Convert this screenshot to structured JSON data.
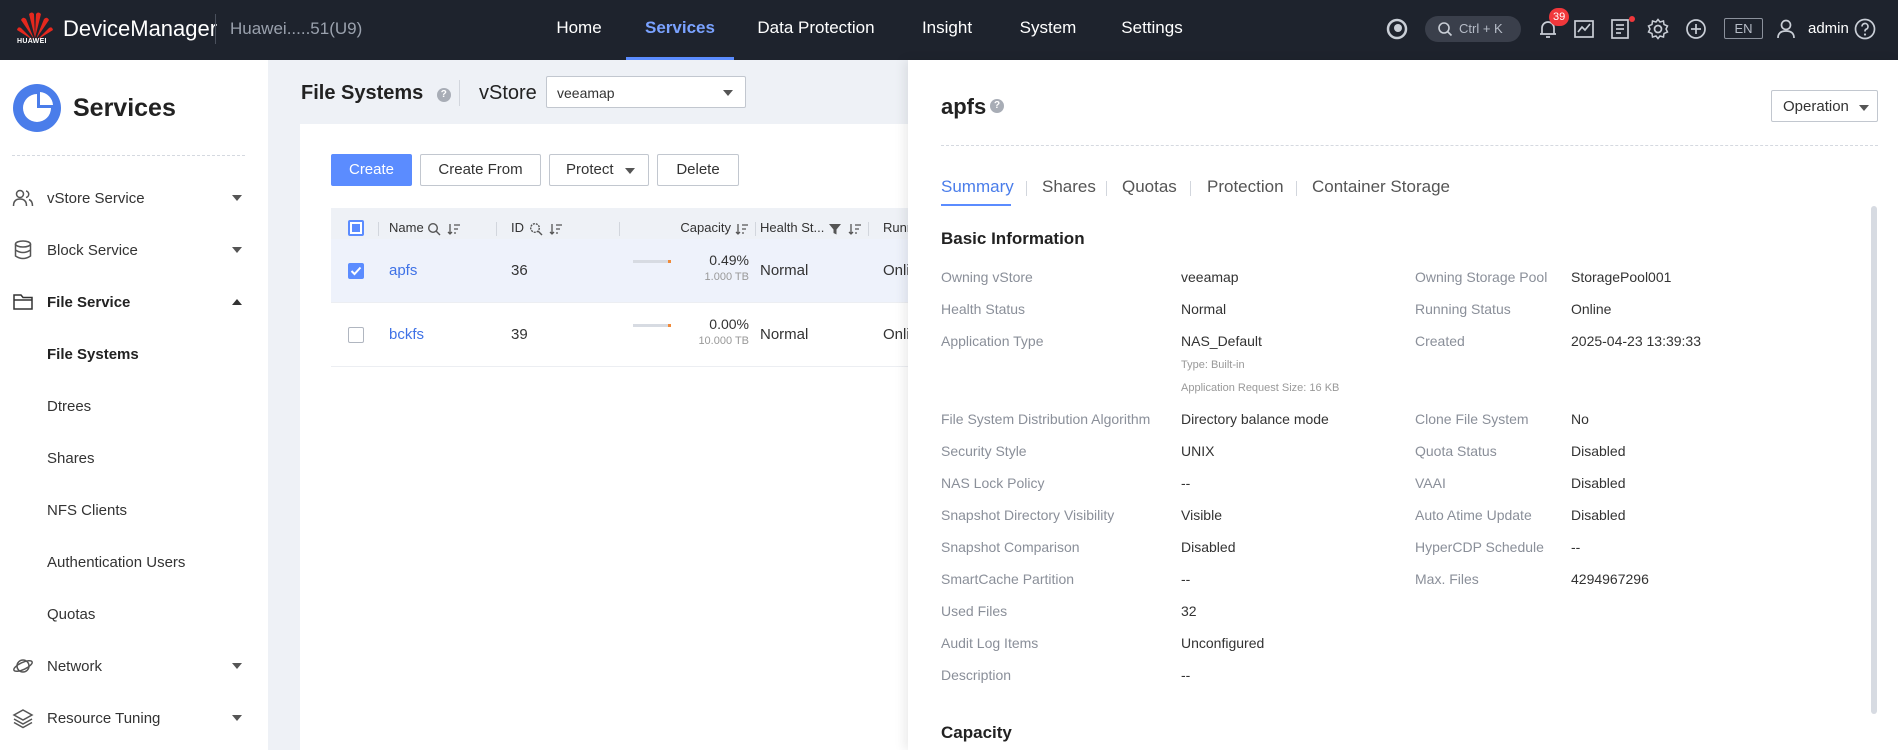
{
  "topbar": {
    "logo_text": "HUAWEI",
    "brand": "DeviceManager",
    "device": "Huawei.....51(U9)",
    "nav": [
      "Home",
      "Services",
      "Data Protection",
      "Insight",
      "System",
      "Settings"
    ],
    "active_nav": "Services",
    "search_hint": "Ctrl + K",
    "alarm_count": "39",
    "language": "EN",
    "user": "admin"
  },
  "sidebar": {
    "title": "Services",
    "items": [
      {
        "label": "vStore Service",
        "icon": "users-icon",
        "expanded": false
      },
      {
        "label": "Block Service",
        "icon": "database-icon",
        "expanded": false
      },
      {
        "label": "File Service",
        "icon": "folder-icon",
        "expanded": true
      },
      {
        "label": "Network",
        "icon": "planet-icon",
        "expanded": false
      },
      {
        "label": "Resource Tuning",
        "icon": "layers-icon",
        "expanded": false
      }
    ],
    "file_service_children": [
      "File Systems",
      "Dtrees",
      "Shares",
      "NFS Clients",
      "Authentication Users",
      "Quotas"
    ],
    "active_child": "File Systems"
  },
  "main": {
    "title": "File Systems",
    "vstore_label": "vStore",
    "vstore_value": "veeamap",
    "buttons": {
      "create": "Create",
      "create_from": "Create From",
      "protect": "Protect",
      "delete": "Delete"
    },
    "columns": [
      "Name",
      "ID",
      "Capacity",
      "Health St...",
      "Runn"
    ],
    "rows": [
      {
        "name": "apfs",
        "id": "36",
        "percent": "0.49%",
        "used_fraction": 0.0049,
        "total": "1.000 TB",
        "health": "Normal",
        "running": "Onli",
        "selected": true
      },
      {
        "name": "bckfs",
        "id": "39",
        "percent": "0.00%",
        "used_fraction": 0.0,
        "total": "10.000 TB",
        "health": "Normal",
        "running": "Onli",
        "selected": false
      }
    ]
  },
  "panel": {
    "title": "apfs",
    "operation": "Operation",
    "tabs": [
      "Summary",
      "Shares",
      "Quotas",
      "Protection",
      "Container Storage"
    ],
    "active_tab": "Summary",
    "section_basic": "Basic Information",
    "section_capacity": "Capacity",
    "left": [
      {
        "label": "Owning vStore",
        "value": "veeamap"
      },
      {
        "label": "Health Status",
        "value": "Normal"
      },
      {
        "label": "Application Type",
        "value": "NAS_Default",
        "subs": [
          "Type: Built-in",
          "Application Request Size: 16 KB"
        ]
      },
      {
        "label": "File System Distribution Algorithm",
        "value": "Directory balance mode"
      },
      {
        "label": "Security Style",
        "value": "UNIX"
      },
      {
        "label": "NAS Lock Policy",
        "value": "--"
      },
      {
        "label": "Snapshot Directory Visibility",
        "value": "Visible"
      },
      {
        "label": "Snapshot Comparison",
        "value": "Disabled"
      },
      {
        "label": "SmartCache Partition",
        "value": "--"
      },
      {
        "label": "Used Files",
        "value": "32"
      },
      {
        "label": "Audit Log Items",
        "value": "Unconfigured"
      },
      {
        "label": "Description",
        "value": "--"
      }
    ],
    "right": [
      {
        "label": "Owning Storage Pool",
        "value": "StoragePool001"
      },
      {
        "label": "Running Status",
        "value": "Online"
      },
      {
        "label": "Created",
        "value": "2025-04-23 13:39:33"
      },
      {
        "label": "Clone File System",
        "value": "No"
      },
      {
        "label": "Quota Status",
        "value": "Disabled"
      },
      {
        "label": "VAAI",
        "value": "Disabled"
      },
      {
        "label": "Auto Atime Update",
        "value": "Disabled"
      },
      {
        "label": "HyperCDP Schedule",
        "value": "--"
      },
      {
        "label": "Max. Files",
        "value": "4294967296"
      }
    ]
  }
}
